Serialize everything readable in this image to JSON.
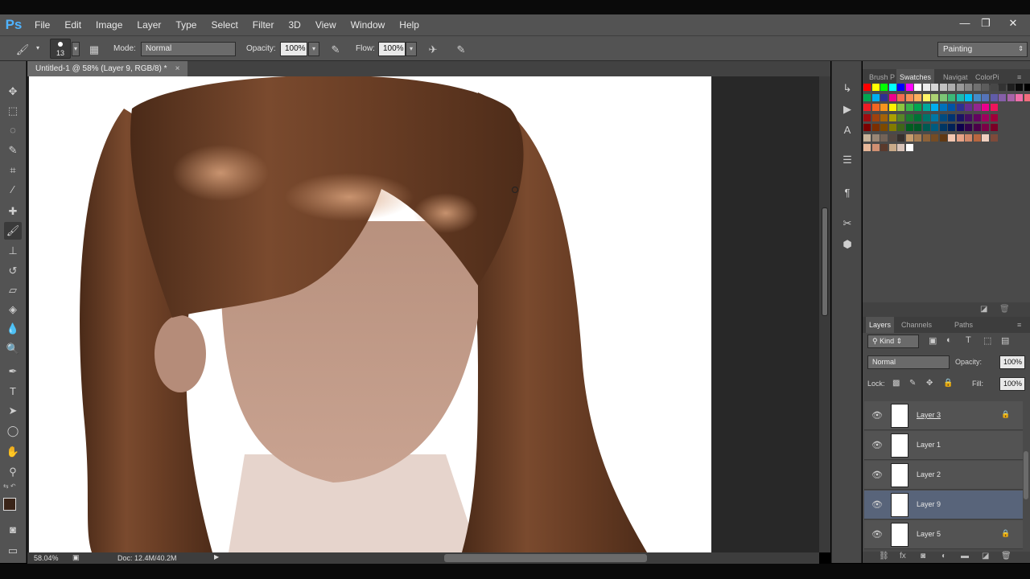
{
  "app": {
    "logo": "Ps",
    "menu": [
      "File",
      "Edit",
      "Image",
      "Layer",
      "Type",
      "Select",
      "Filter",
      "3D",
      "View",
      "Window",
      "Help"
    ],
    "window_controls": [
      "—",
      "❐",
      "✕"
    ]
  },
  "options_bar": {
    "brush_size": "13",
    "mode_label": "Mode:",
    "mode_value": "Normal",
    "opacity_label": "Opacity:",
    "opacity_value": "100%",
    "flow_label": "Flow:",
    "flow_value": "100%",
    "workspace": "Painting"
  },
  "document": {
    "tab_title": "Untitled-1 @ 58% (Layer 9, RGB/8) *",
    "tab_close": "×"
  },
  "status_bar": {
    "zoom": "58.04%",
    "doc_info": "Doc: 12.4M/40.2M"
  },
  "panels": {
    "top_tabs": [
      "Brush P",
      "Swatches",
      "Navigat",
      "ColorPi"
    ],
    "active_top_tab": "Swatches",
    "layers_tabs": [
      "Layers",
      "Channels",
      "Paths"
    ],
    "filter_kind": "Kind",
    "blend_mode": "Normal",
    "opacity_label": "Opacity:",
    "opacity_value": "100%",
    "lock_label": "Lock:",
    "fill_label": "Fill:",
    "fill_value": "100%",
    "layers": [
      {
        "name": "Layer 3",
        "locked": true,
        "selected": false
      },
      {
        "name": "Layer 1",
        "locked": false,
        "selected": false
      },
      {
        "name": "Layer 2",
        "locked": false,
        "selected": false
      },
      {
        "name": "Layer 9",
        "locked": false,
        "selected": true
      },
      {
        "name": "Layer 5",
        "locked": true,
        "selected": false
      }
    ]
  },
  "colors": {
    "foreground": "#3a2418",
    "background": "#ffffff",
    "hair": "#6b3f26",
    "skin": "#c7a08d"
  }
}
